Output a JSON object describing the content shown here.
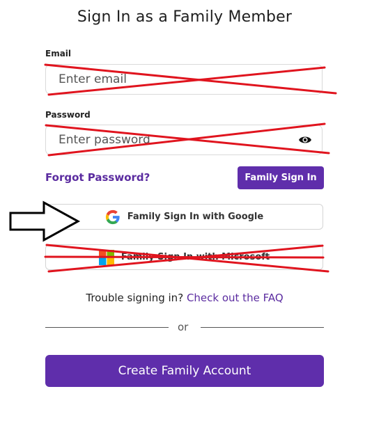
{
  "title": "Sign In as a Family Member",
  "email": {
    "label": "Email",
    "placeholder": "Enter email"
  },
  "password": {
    "label": "Password",
    "placeholder": "Enter password"
  },
  "forgot_label": "Forgot Password?",
  "sign_in_label": "Family Sign In",
  "google_label": "Family Sign In with Google",
  "microsoft_label": "Family Sign In with Microsoft",
  "trouble": {
    "text": "Trouble signing in?",
    "link": "Check out the FAQ"
  },
  "divider_text": "or",
  "create_label": "Create Family Account",
  "colors": {
    "accent": "#5f2eab",
    "strike": "#e0141e"
  },
  "icons": [
    "eye-icon",
    "google-logo-icon",
    "microsoft-logo-icon",
    "arrow-pointer-icon"
  ]
}
